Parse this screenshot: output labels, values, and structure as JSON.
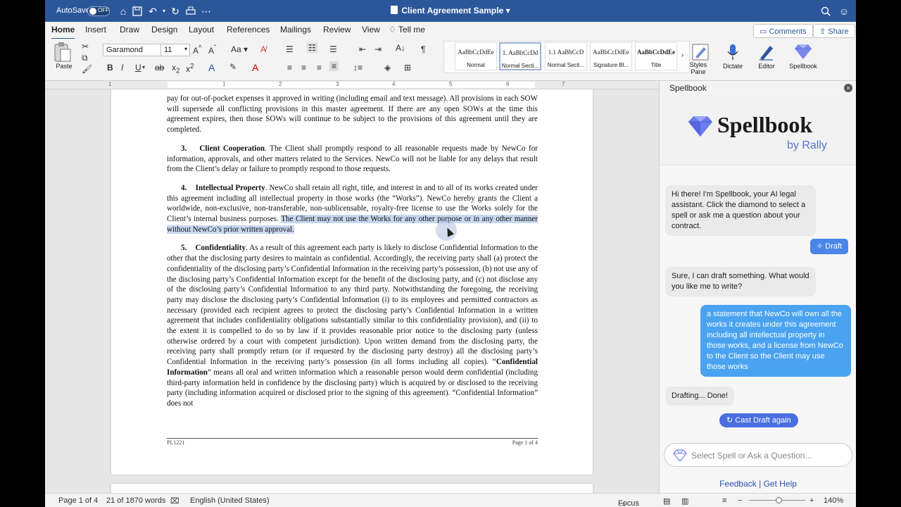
{
  "titlebar": {
    "autosave_label": "AutoSave",
    "autosave_state": "OFF",
    "doc_title": "Client Agreement Sample"
  },
  "tabs": [
    "Home",
    "Insert",
    "Draw",
    "Design",
    "Layout",
    "References",
    "Mailings",
    "Review",
    "View"
  ],
  "tell_me": "Tell me",
  "top_buttons": {
    "comments": "Comments",
    "share": "Share"
  },
  "ribbon": {
    "paste": "Paste",
    "font": "Garamond",
    "size": "11",
    "styles": [
      {
        "sample": "AaBbCcDdEe",
        "name": "Normal"
      },
      {
        "sample": "1.  AaBbCcDd",
        "name": "Normal Secti..."
      },
      {
        "sample": "1.1  AaBbCcD",
        "name": "Normal Secti..."
      },
      {
        "sample": "AaBbCcDdEe",
        "name": "Signature Bl..."
      },
      {
        "sample": "AaBbCcDdEe",
        "name": "Title"
      }
    ],
    "styles_pane": "Styles Pane",
    "dictate": "Dictate",
    "editor": "Editor",
    "spellbook": "Spellbook"
  },
  "ruler_numbers": [
    "1",
    "1",
    "2",
    "3",
    "4",
    "5",
    "6",
    "7"
  ],
  "document": {
    "para0": "pay for out-of-pocket expenses it approved in writing (including email and text message). All provisions in each SOW will supersede all conflicting provisions in this master agreement. If there are any open SOWs at the time this agreement expires, then those SOWs will continue to be subject to the provisions of this agreement until they are completed.",
    "p3_num": "3.",
    "p3_head": "Client Cooperation",
    "p3_text": ". The Client shall promptly respond to all reasonable requests made by NewCo for information, approvals, and other matters related to the Services. NewCo will not be liable for any delays that result from the Client’s delay or failure to promptly respond to those requests.",
    "p4_num": "4.",
    "p4_head": "Intellectual Property",
    "p4_text": ". NewCo shall retain all right, title, and interest in and to all of its works created under this agreement including all intellectual property in those works (the “Works”). NewCo hereby grants the Client a worldwide, non-exclusive, non-transferable, non-sublicensable, royalty-free license to use the Works solely for the Client’s internal business purposes. ",
    "p4_highlight": "The Client may not use the Works for any other purpose or in any other manner without NewCo’s prior written approval.",
    "p5_num": "5.",
    "p5_head": "Confidentiality",
    "p5_text": ". As a result of this agreement each party is likely to disclose Confidential Information to the other that the disclosing party desires to maintain as confidential. Accordingly, the receiving party shall (a) protect the confidentiality of the disclosing party’s Confidential Information in the receiving party’s possession, (b) not use any of the disclosing party’s Confidential Information except for the benefit of the disclosing party, and (c) not disclose any of the disclosing party’s Confidential Information to any third party. Notwithstanding the foregoing, the receiving party may disclose the disclosing party’s Confidential Information (i) to its employees and permitted contractors as necessary (provided each recipient agrees to protect the disclosing party’s Confidential Information in a written agreement that includes confidentiality obligations substantially similar to this confidentiality provision), and (ii) to the extent it is compelled to do so by law if it provides reasonable prior notice to the disclosing party (unless otherwise ordered by a court with competent jurisdiction). Upon written demand from the disclosing party, the receiving party shall promptly return (or if requested by the disclosing party destroy) all the disclosing party’s Confidential Information in the receiving party’s possession (in all forms including all copies). “",
    "p5_term": "Confidential Information",
    "p5_tail": "” means all oral and written information which a reasonable person would deem confidential (including third-party information held in confidence by the disclosing party) which is acquired by or disclosed to the receiving party (including information acquired or disclosed prior to the signing of this agreement). “Confidential Information” does not",
    "footer_left": "PL1221",
    "footer_right": "Page 1 of 4"
  },
  "statusbar": {
    "page": "Page 1 of 4",
    "words": "21 of 1870 words",
    "language": "English (United States)",
    "focus": "Focus",
    "zoom": "140%"
  },
  "pane": {
    "title": "Spellbook",
    "brand": "Spellbook",
    "by": "by Rally",
    "msg1": "Hi there! I'm Spellbook, your AI legal assistant. Click the diamond to select a spell or ask me a question about your contract.",
    "draft_button": "Draft",
    "msg2": "Sure, I can draft something. What would you like me to write?",
    "user_msg": "a statement that NewCo will own all the works it creates under this agreement including all intellectual property in those works, and a license from NewCo to the Client so the Client may use those works",
    "msg3": "Drafting... Done!",
    "cast_again": "Cast Draft again",
    "ask_placeholder": "Select Spell or Ask a Question...",
    "feedback": "Feedback",
    "sep": "|",
    "help": "Get Help"
  },
  "colors": {
    "word_blue": "#2b579a",
    "spellbook_accent": "#5b72c9",
    "user_bubble": "#4aa3f0",
    "selection": "#c6d7f0"
  }
}
